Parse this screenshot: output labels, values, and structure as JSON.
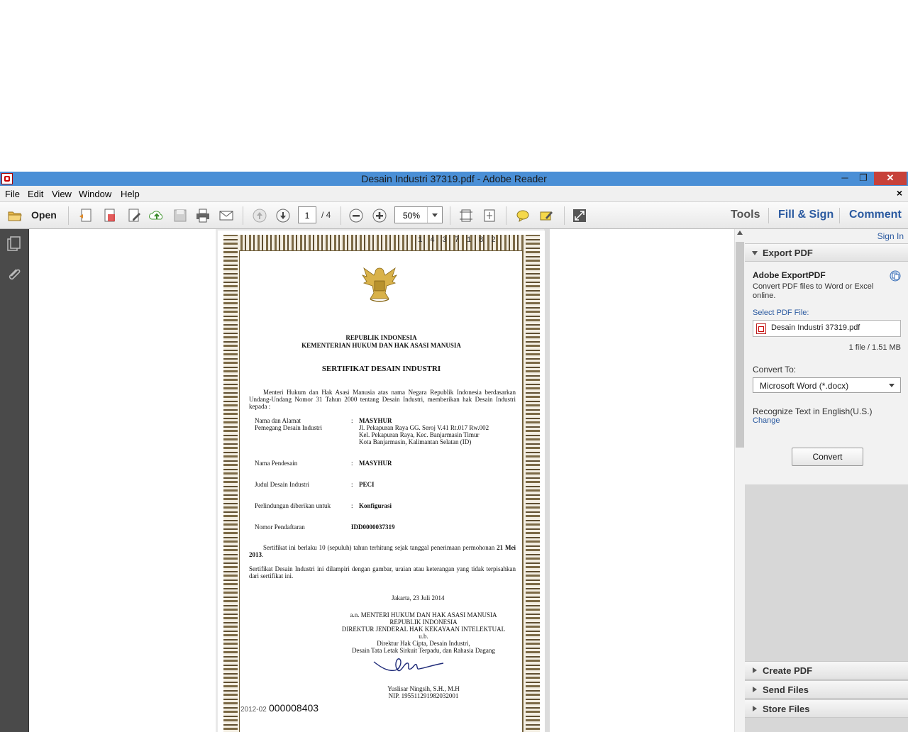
{
  "window": {
    "title": "Desain Industri 37319.pdf - Adobe Reader",
    "controls": {
      "minimize": "─",
      "restore": "❐",
      "close": "✕"
    }
  },
  "menu": {
    "items": [
      "File",
      "Edit",
      "View",
      "Window",
      "Help"
    ],
    "close_doc": "×"
  },
  "toolbar": {
    "open_label": "Open",
    "page_current": "1",
    "page_total": "/ 4",
    "zoom": "50%",
    "tabs": [
      "Tools",
      "Fill & Sign",
      "Comment"
    ]
  },
  "document": {
    "serial_top": "1 4 3 7 1 8 2",
    "header_line1": "REPUBLIK INDONESIA",
    "header_line2": "KEMENTERIAN HUKUM DAN HAK ASASI MANUSIA",
    "cert_title": "SERTIFIKAT DESAIN INDUSTRI",
    "intro": "Menteri Hukum dan Hak Asasi Manusia atas nama Negara Republik Indonesia berdasarkan Undang-Undang Nomor 31 Tahun 2000 tentang Desain Industri, memberikan hak Desain Industri kepada :",
    "fields": [
      {
        "label": "Nama dan Alamat",
        "label2": "Pemegang Desain Industri",
        "value": "MASYHUR",
        "extra": [
          "Jl. Pekapuran Raya GG. Seroj V.41 Rt.017 Rw.002",
          "Kel. Pekapuran Raya, Kec. Banjarmasin Timur",
          "Kota Banjarmasin, Kalimantan Selatan (ID)"
        ]
      },
      {
        "label": "Nama Pendesain",
        "value": "MASYHUR"
      },
      {
        "label": "Judul Desain Industri",
        "value": "PECI"
      },
      {
        "label": "Perlindungan diberikan untuk",
        "value": "Konfigurasi"
      },
      {
        "label": "Nomor Pendaftaran",
        "value": "IDD0000037319"
      }
    ],
    "colon": ":",
    "validity": "Sertifikat ini berlaku 10 (sepuluh) tahun terhitung sejak tanggal penerimaan permohonan",
    "validity_date": "21 Mei 2013",
    "attachment": "Sertifikat Desain Industri ini dilampiri dengan gambar, uraian atau keterangan yang tidak terpisahkan dari sertifikat ini.",
    "place_date": "Jakarta, 23 Juli 2014",
    "sign_lines": [
      "a.n. MENTERI HUKUM DAN HAK ASASI MANUSIA",
      "REPUBLIK INDONESIA",
      "DIREKTUR JENDERAL HAK KEKAYAAN INTELEKTUAL",
      "u.b.",
      "Direktur Hak Cipta, Desain Industri,",
      "Desain Tata Letak Sirkuit Terpadu, dan Rahasia Dagang"
    ],
    "signer": "Yuslisar Ningsih, S.H., M.H",
    "nip": "NIP. 195511291982032001",
    "serial_prefix": "2012-02",
    "serial_number": "000008403"
  },
  "panel": {
    "sign_in": "Sign In",
    "export_header": "Export PDF",
    "export_title": "Adobe ExportPDF",
    "export_desc": "Convert PDF files to Word or Excel online.",
    "select_label": "Select PDF File:",
    "file_name": "Desain Industri 37319.pdf",
    "file_size": "1 file / 1.51 MB",
    "convert_to_label": "Convert To:",
    "convert_to_value": "Microsoft Word (*.docx)",
    "recognize": "Recognize Text in English(U.S.)",
    "change": "Change",
    "convert_btn": "Convert",
    "sections": [
      "Create PDF",
      "Send Files",
      "Store Files"
    ]
  }
}
